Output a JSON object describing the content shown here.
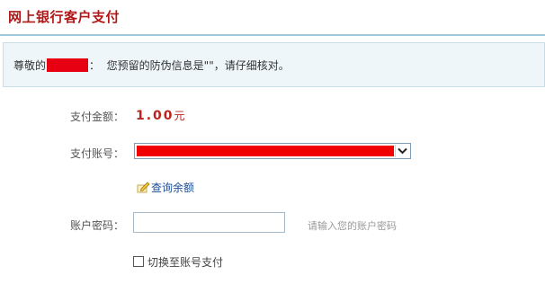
{
  "header": {
    "title": "网上银行客户支付"
  },
  "notice": {
    "greeting_prefix": "尊敬的",
    "greeting_suffix": "：",
    "message": "您预留的防伪信息是\"\"，请仔细核对。"
  },
  "form": {
    "amount_label": "支付金额：",
    "amount_value": "1.00",
    "amount_unit": "元",
    "account_label": "支付账号：",
    "query_balance_link": "查询余额",
    "password_label": "账户密码：",
    "password_value": "",
    "password_hint": "请输入您的账户密码",
    "switch_label": "切换至账号支付"
  },
  "colors": {
    "title": "#b01818",
    "amount": "#b8251e",
    "redaction": "#e60012",
    "link": "#1a4c98",
    "notice_bg": "#eef6fa",
    "header_border": "#9fc8dc"
  },
  "icons": {
    "query_balance": "pencil-note-icon",
    "account_dropdown": "chevron-down-icon",
    "switch_checkbox": "checkbox-unchecked"
  }
}
